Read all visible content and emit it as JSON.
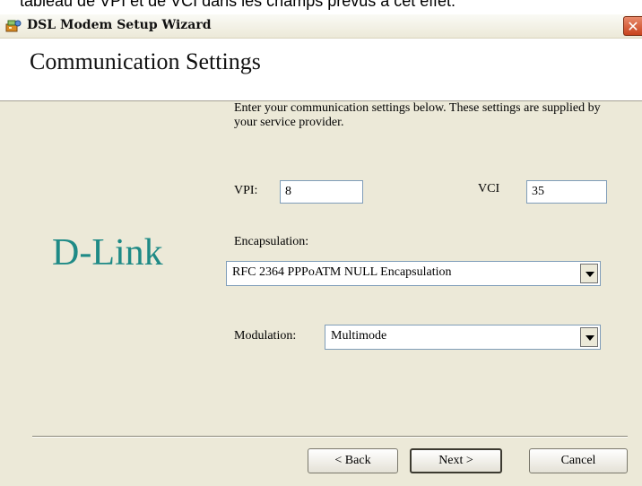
{
  "caption": {
    "text": "tableau de VPI et de VCI dans les champs prévus à cet effet."
  },
  "window": {
    "title": "DSL Modem Setup Wizard",
    "close_symbol": "✕"
  },
  "header": {
    "title": "Communication Settings"
  },
  "brand": {
    "logo_text": "D-Link",
    "color": "#1e8a86"
  },
  "intro": {
    "text": "Enter your communication settings below.  These settings are supplied by your service provider."
  },
  "vpi": {
    "label": "VPI:",
    "value": "8"
  },
  "vci": {
    "label": "VCI",
    "value": "35"
  },
  "encapsulation": {
    "label": "Encapsulation:",
    "selected": "RFC 2364 PPPoATM NULL Encapsulation"
  },
  "modulation": {
    "label": "Modulation:",
    "selected": "Multimode"
  },
  "buttons": {
    "back": "< Back",
    "next": "Next >",
    "cancel": "Cancel"
  },
  "colors": {
    "close_button": "#c8431e",
    "dialog_bg": "#ece9d8",
    "field_border": "#7f9db9"
  }
}
